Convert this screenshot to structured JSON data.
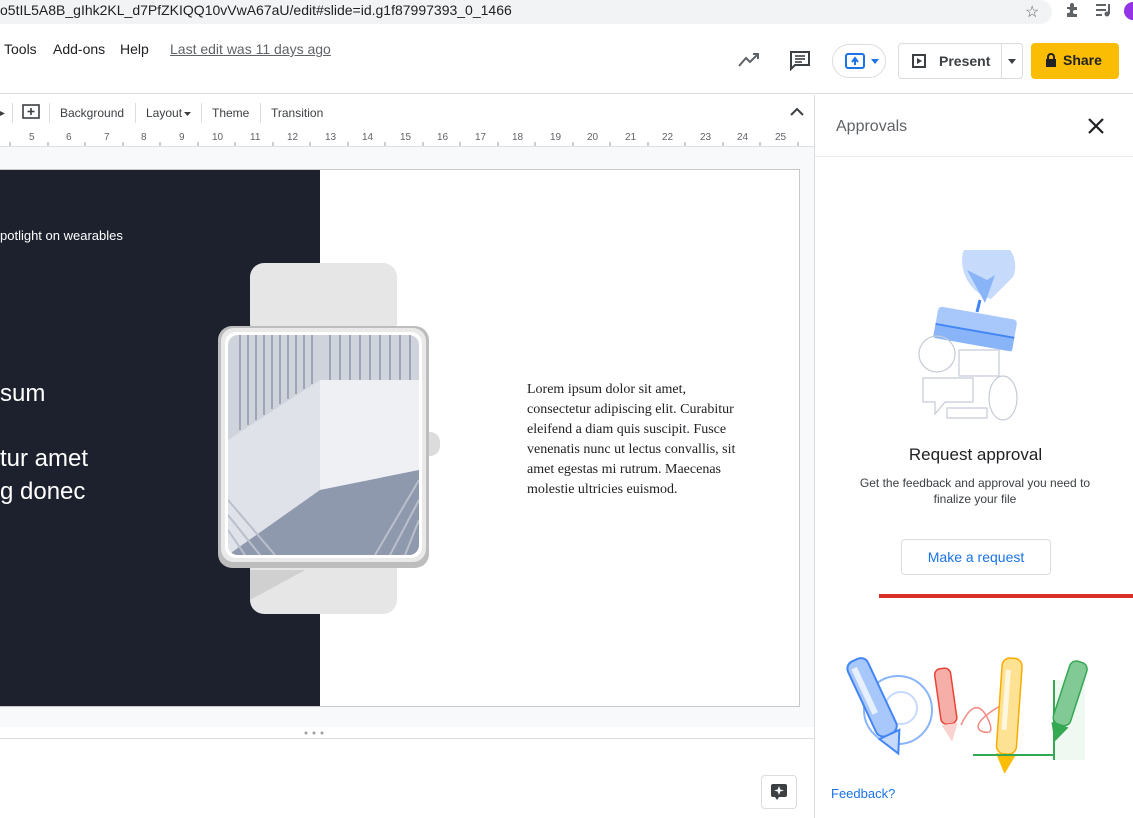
{
  "browser": {
    "url": "o5tIL5A8B_gIhk2KL_d7PfZKIQQ10vVwA67aU/edit#slide=id.g1f87997393_0_1466"
  },
  "menu": {
    "tools": "Tools",
    "addons": "Add-ons",
    "help": "Help",
    "last_edit": "Last edit was 11 days ago"
  },
  "header": {
    "present": "Present",
    "share": "Share"
  },
  "toolbar": {
    "background": "Background",
    "layout": "Layout",
    "theme": "Theme",
    "transition": "Transition"
  },
  "ruler": [
    "5",
    "6",
    "7",
    "8",
    "9",
    "10",
    "11",
    "12",
    "13",
    "14",
    "15",
    "16",
    "17",
    "18",
    "19",
    "20",
    "21",
    "22",
    "23",
    "24",
    "25"
  ],
  "slide": {
    "spotlight": "potlight on wearables",
    "line1": "sum",
    "line2": "tur amet",
    "line3": "g donec",
    "body": "Lorem ipsum dolor sit amet, consectetur adipiscing elit. Curabitur eleifend a diam quis suscipit. Fusce venenatis nunc ut lectus convallis, sit amet egestas mi rutrum. Maecenas molestie ultricies euismod."
  },
  "panel": {
    "title": "Approvals",
    "request_title": "Request approval",
    "request_desc": "Get the feedback and approval you need to finalize your file",
    "make_request": "Make a request",
    "feedback": "Feedback?"
  },
  "colors": {
    "share": "#fbbc04",
    "dark_panel": "#1c212d",
    "link": "#1a73e8",
    "annotation_line": "#d93025"
  }
}
